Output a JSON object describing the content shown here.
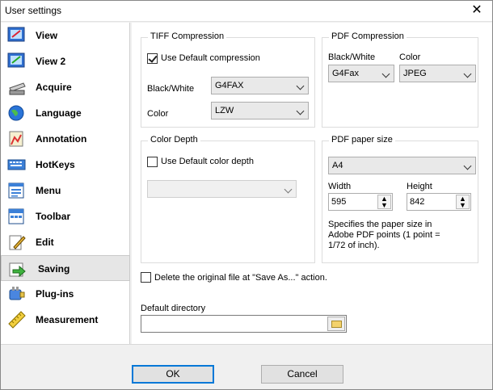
{
  "window": {
    "title": "User settings",
    "close_glyph": "✕"
  },
  "sidebar": {
    "items": [
      {
        "label": "View",
        "icon": "view-icon"
      },
      {
        "label": "View 2",
        "icon": "view2-icon"
      },
      {
        "label": "Acquire",
        "icon": "scanner-icon"
      },
      {
        "label": "Language",
        "icon": "globe-icon"
      },
      {
        "label": "Annotation",
        "icon": "annotation-icon"
      },
      {
        "label": "HotKeys",
        "icon": "keyboard-icon"
      },
      {
        "label": "Menu",
        "icon": "menu-icon"
      },
      {
        "label": "Toolbar",
        "icon": "toolbar-icon"
      },
      {
        "label": "Edit",
        "icon": "edit-icon"
      },
      {
        "label": "Saving",
        "icon": "saving-icon",
        "selected": true
      },
      {
        "label": "Plug-ins",
        "icon": "plugin-icon"
      },
      {
        "label": "Measurement",
        "icon": "ruler-icon"
      }
    ]
  },
  "tiff": {
    "title": "TIFF Compression",
    "use_default_label": "Use Default compression",
    "use_default_checked": true,
    "bw_label": "Black/White",
    "bw_value": "G4FAX",
    "color_label": "Color",
    "color_value": "LZW"
  },
  "pdf": {
    "title": "PDF Compression",
    "bw_label": "Black/White",
    "bw_value": "G4Fax",
    "color_label": "Color",
    "color_value": "JPEG"
  },
  "depth": {
    "title": "Color Depth",
    "use_default_label": "Use Default color depth",
    "use_default_checked": false,
    "value": ""
  },
  "paper": {
    "title": "PDF paper size",
    "size_value": "A4",
    "width_label": "Width",
    "width_value": "595",
    "height_label": "Height",
    "height_value": "842",
    "description": "Specifies the paper size in Adobe PDF points (1 point = 1/72 of inch)."
  },
  "delete_original": {
    "label": "Delete the original file at \"Save As...\" action.",
    "checked": false
  },
  "directory": {
    "label": "Default directory",
    "value": ""
  },
  "buttons": {
    "ok": "OK",
    "cancel": "Cancel"
  },
  "colors": {
    "accent": "#0078d7",
    "selected_bg": "#e6e6e6"
  }
}
